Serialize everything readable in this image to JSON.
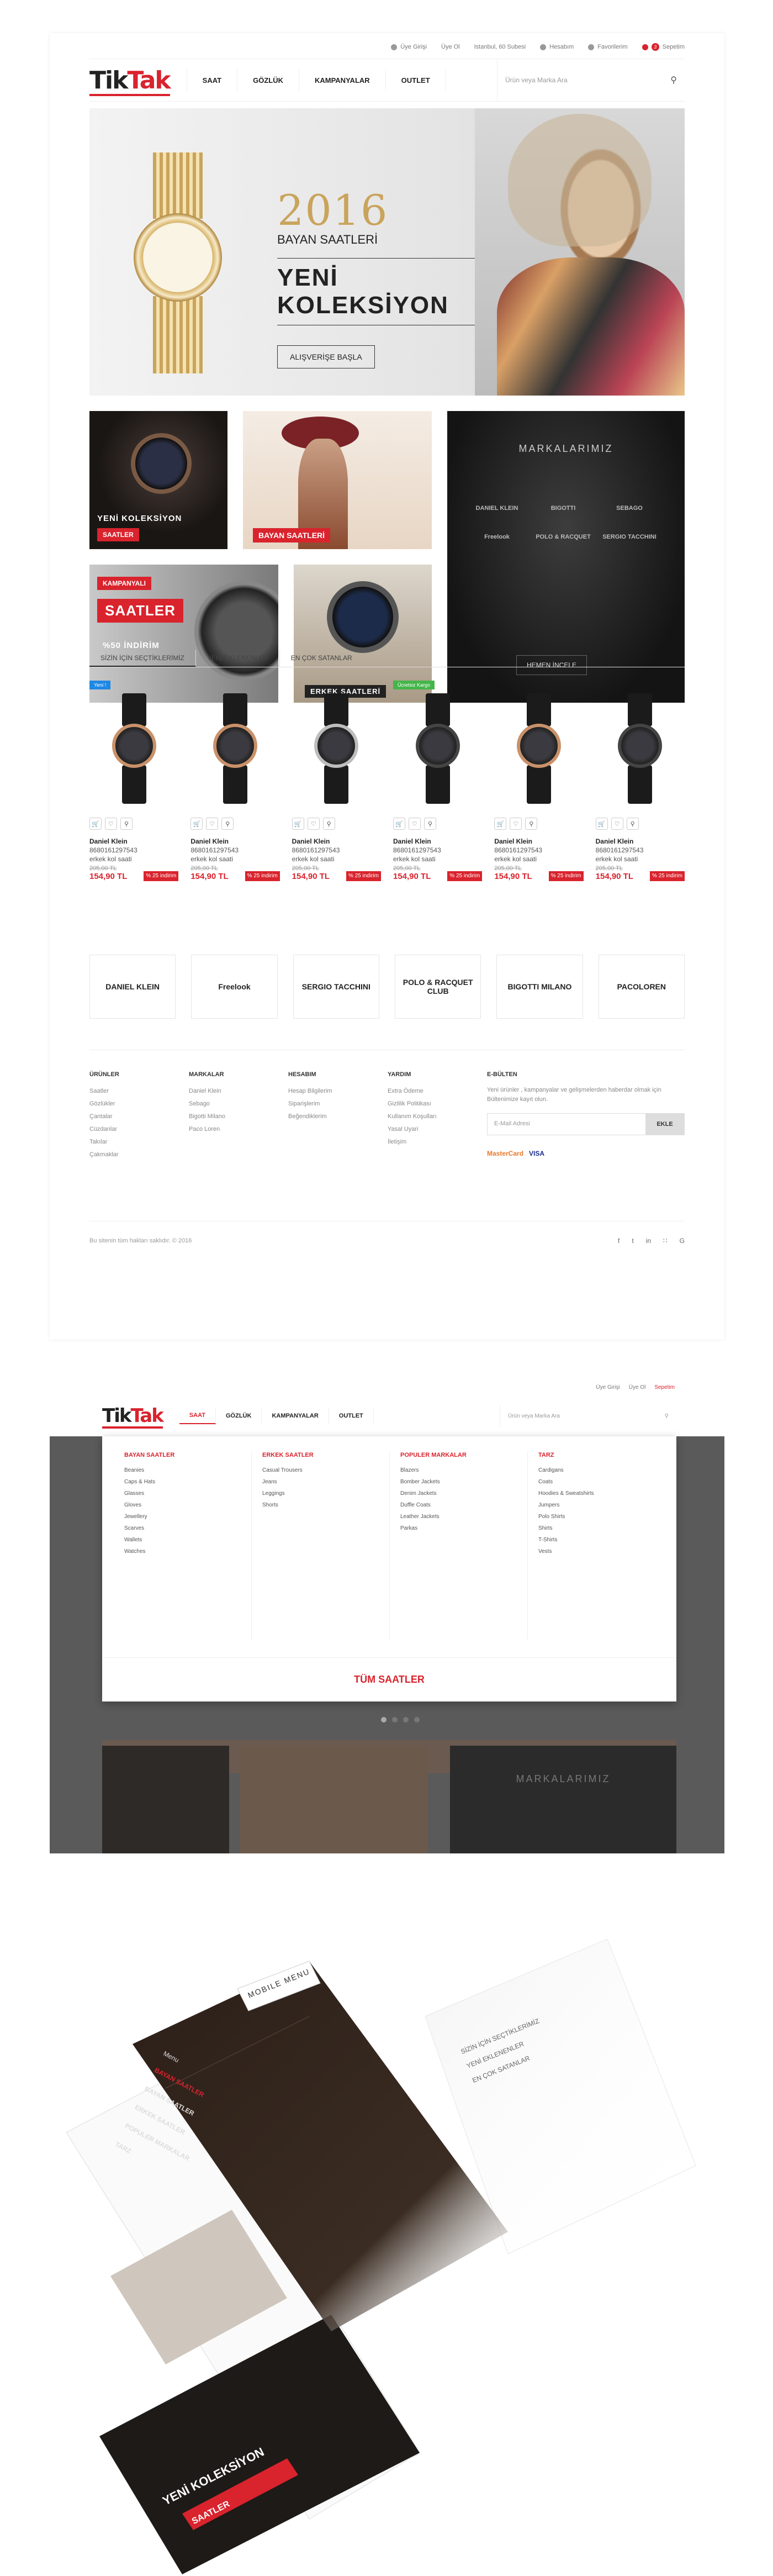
{
  "header": {
    "top_links": [
      "Üye Girişi",
      "Üye Ol",
      "Istanbul, 60 Subesi",
      "Hesabım",
      "Favorilerim",
      "Sepetim"
    ],
    "cart_count": "3",
    "logo_a": "Tik",
    "logo_b": "Tak",
    "nav": [
      "SAAT",
      "GÖZLÜK",
      "KAMPANYALAR",
      "OUTLET"
    ],
    "search_placeholder": "Ürün veya Marka Ara"
  },
  "hero": {
    "year": "2016",
    "subtitle": "BAYAN SAATLERİ",
    "title": "YENİ KOLEKSİYON",
    "button": "ALIŞVERİŞE BAŞLA"
  },
  "tiles": {
    "new_collection": "YENİ KOLEKSİYON",
    "new_collection_sub": "SAATLER",
    "ladies": "BAYAN SAATLERİ",
    "campaign_tag": "KAMPANYALI",
    "campaign_title": "SAATLER",
    "campaign_discount": "%50 İNDİRİM",
    "men": "ERKEK SAATLERİ",
    "brands_title": "MARKALARIMIZ",
    "brands_button": "HEMEN İNCELE",
    "brand_names": [
      "DANIEL KLEIN",
      "BIGOTTI",
      "SEBAGO",
      "Freelook",
      "POLO & RACQUET",
      "SERGIO TACCHINI"
    ]
  },
  "tabs": [
    "SİZİN İÇİN SEÇTİKLERİMİZ",
    "YENİ EKLENENLER",
    "EN ÇOK SATANLAR"
  ],
  "products": [
    {
      "tag": "Yeni !",
      "tag_color": "#1e88e5",
      "brand": "Daniel Klein",
      "code": "8680161297543",
      "name": "erkek kol saati",
      "old": "205,00 TL",
      "new": "154,90 TL",
      "disc": "% 25 indirim"
    },
    {
      "tag": "",
      "tag_color": "",
      "brand": "Daniel Klein",
      "code": "8680161297543",
      "name": "erkek kol saati",
      "old": "205,00 TL",
      "new": "154,90 TL",
      "disc": "% 25 indirim"
    },
    {
      "tag": "",
      "tag_color": "",
      "brand": "Daniel Klein",
      "code": "8680161297543",
      "name": "erkek kol saati",
      "old": "205,00 TL",
      "new": "154,90 TL",
      "disc": "% 25 indirim"
    },
    {
      "tag": "Ücretsiz Kargo",
      "tag_color": "#43b649",
      "brand": "Daniel Klein",
      "code": "8680161297543",
      "name": "erkek kol saati",
      "old": "205,00 TL",
      "new": "154,90 TL",
      "disc": "% 25 indirim"
    },
    {
      "tag": "",
      "tag_color": "",
      "brand": "Daniel Klein",
      "code": "8680161297543",
      "name": "erkek kol saati",
      "old": "205,00 TL",
      "new": "154,90 TL",
      "disc": "% 25 indirim"
    },
    {
      "tag": "",
      "tag_color": "",
      "brand": "Daniel Klein",
      "code": "8680161297543",
      "name": "erkek kol saati",
      "old": "205,00 TL",
      "new": "154,90 TL",
      "disc": "% 25 indirim"
    }
  ],
  "brand_logos": [
    "DANIEL KLEIN",
    "Freelook",
    "SERGIO TACCHINI",
    "POLO & RACQUET CLUB",
    "BIGOTTI MILANO",
    "PACOLOREN"
  ],
  "footer": {
    "cols": [
      {
        "title": "ÜRÜNLER",
        "items": [
          "Saatler",
          "Gözlükler",
          "Çantalar",
          "Cüzdanlar",
          "Takılar",
          "Çakmaklar"
        ]
      },
      {
        "title": "MARKALAR",
        "items": [
          "Daniel Klein",
          "Sebago",
          "Bigotti Milano",
          "Paco Loren"
        ]
      },
      {
        "title": "HESABIM",
        "items": [
          "Hesap Bilgilerim",
          "Siparişlerim",
          "Beğendiklerim"
        ]
      },
      {
        "title": "YARDIM",
        "items": [
          "Extra Ödeme",
          "Gizlilik Politikası",
          "Kullanım Koşulları",
          "Yasal Uyari",
          "İletişim"
        ]
      }
    ],
    "newsletter_title": "E-BÜLTEN",
    "newsletter_text": "Yeni ürünler , kampanyalar ve gelişmelerden haberdar olmak için Bültenimize kayıt olun.",
    "email_placeholder": "E-Mail Adresi",
    "email_button": "EKLE",
    "payments": [
      "MasterCard",
      "VISA"
    ],
    "copyright": "Bu sitenin tüm hakları saklıdır. © 2016"
  },
  "mega": {
    "top_links": [
      "Üye Girişi",
      "Üye Ol",
      "Sepetim"
    ],
    "search_placeholder": "Ürün veya Marka Ara",
    "cols": [
      {
        "title": "BAYAN SAATLER",
        "items": [
          "Beanies",
          "Caps & Hats",
          "Glasses",
          "Gloves",
          "Jewellery",
          "Scarves",
          "Wallets",
          "Watches"
        ]
      },
      {
        "title": "ERKEK SAATLER",
        "items": [
          "Casual Trousers",
          "Jeans",
          "Leggings",
          "Shorts"
        ]
      },
      {
        "title": "POPULER MARKALAR",
        "items": [
          "Blazers",
          "Bomber Jackets",
          "Denim Jackets",
          "Duffle Coats",
          "Leather Jackets",
          "Parkas"
        ]
      },
      {
        "title": "TARZ",
        "items": [
          "Cardigans",
          "Coats",
          "Hoodies & Sweatshirts",
          "Jumpers",
          "Polo Shirts",
          "Shirts",
          "T-Shirts",
          "Vests"
        ]
      }
    ],
    "footer": "TÜM SAATLER",
    "bg_brands_title": "MARKALARIMIZ"
  },
  "mobile": {
    "banner": "MOBILE MENU",
    "menu_title": "Menu",
    "items": [
      "BAYAN SAATLER",
      "BAYAN SAATLER",
      "ERKEK SAATLER",
      "POPULER MARKALAR",
      "TARZ"
    ],
    "tabs": [
      "SİZİN İÇİN SEÇTİKLERİMİZ",
      "YENİ EKLENENLER",
      "EN ÇOK SATANLAR"
    ],
    "card_title": "YENİ KOLEKSİYON",
    "card_sub": "SAATLER"
  }
}
